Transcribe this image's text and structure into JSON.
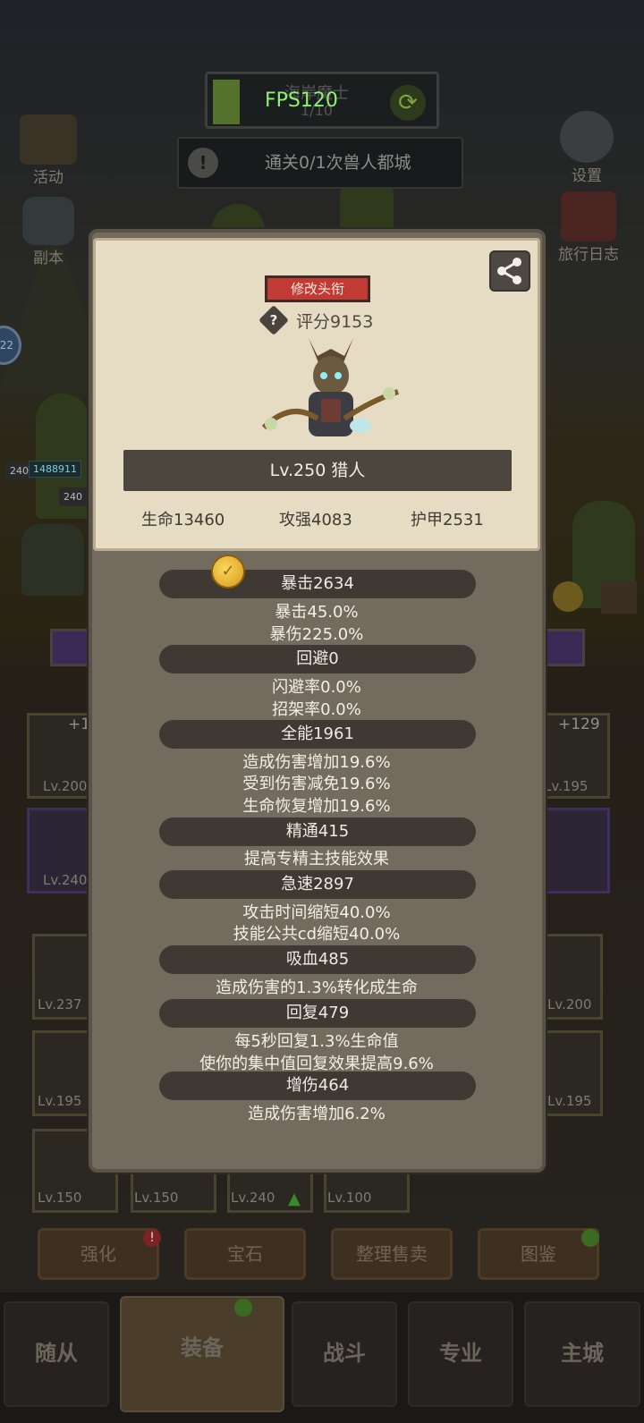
{
  "hud": {
    "fps": "FPS120",
    "ghost_title": "海岸魔士",
    "ghost_progress": "1/10",
    "quest": "通关0/1次兽人都城",
    "left_buttons": [
      "活动",
      "副本"
    ],
    "right_buttons": [
      "设置",
      "旅行日志"
    ],
    "bubble_num": "22",
    "hp_left": "1488911",
    "lvl_chip": "240"
  },
  "equipment_grid": {
    "top_left_plus": "+1",
    "top_right_plus": "+129",
    "labels": [
      "Lv.200",
      "Lv.195",
      "Lv.240",
      "Lv.237",
      "Lv.200",
      "Lv.195",
      "Lv.195",
      "Lv.150",
      "Lv.150",
      "Lv.240",
      "Lv.100"
    ]
  },
  "bottom_buttons": [
    "强化",
    "宝石",
    "整理售卖",
    "图鉴"
  ],
  "nav": [
    "随从",
    "装备",
    "战斗",
    "专业",
    "主城"
  ],
  "profile": {
    "change_title": "修改头衔",
    "score": "评分9153",
    "help_glyph": "?",
    "level_class": "Lv.250 猎人",
    "hp": "生命13460",
    "attack": "攻强4083",
    "armor": "护甲2531"
  },
  "stats": [
    {
      "head": "暴击2634",
      "lines": [
        "暴击45.0%",
        "暴伤225.0%"
      ]
    },
    {
      "head": "回避0",
      "lines": [
        "闪避率0.0%",
        "招架率0.0%"
      ]
    },
    {
      "head": "全能1961",
      "lines": [
        "造成伤害增加19.6%",
        "受到伤害减免19.6%",
        "生命恢复增加19.6%"
      ]
    },
    {
      "head": "精通415",
      "lines": [
        "提高专精主技能效果"
      ]
    },
    {
      "head": "急速2897",
      "lines": [
        "攻击时间缩短40.0%",
        "技能公共cd缩短40.0%"
      ]
    },
    {
      "head": "吸血485",
      "lines": [
        "造成伤害的1.3%转化成生命"
      ]
    },
    {
      "head": "回复479",
      "lines": [
        "每5秒回复1.3%生命值",
        "使你的集中值回复效果提高9.6%"
      ]
    },
    {
      "head": "增伤464",
      "lines": [
        "造成伤害增加6.2%"
      ]
    }
  ]
}
